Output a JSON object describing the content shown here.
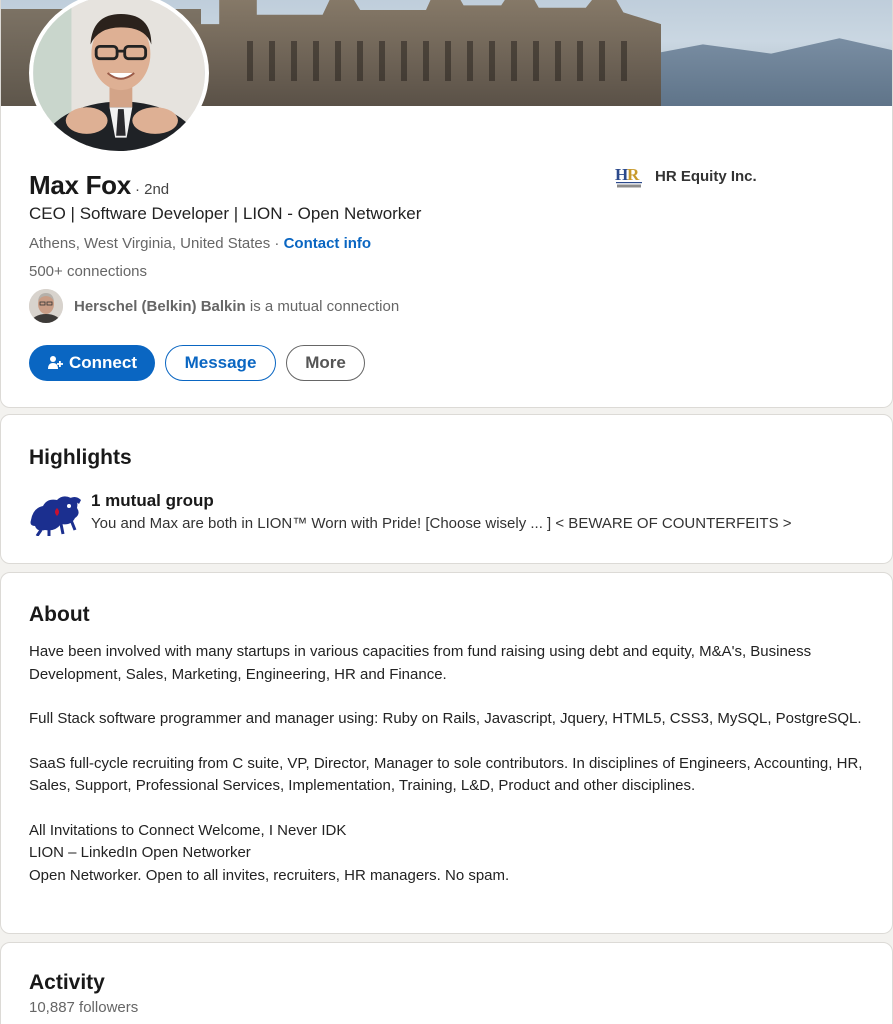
{
  "profile": {
    "name": "Max Fox",
    "degree": "· 2nd",
    "headline": "CEO | Software Developer | LION - Open Networker",
    "location": "Athens, West Virginia, United States",
    "location_separator": " · ",
    "contact_info": "Contact info",
    "connections": "500+ connections",
    "mutual": {
      "name": "Herschel (Belkin) Balkin",
      "suffix": " is a mutual connection"
    },
    "actions": {
      "connect": "Connect",
      "message": "Message",
      "more": "More"
    },
    "company": {
      "name": "HR Equity Inc.",
      "logo_icon": "hr-equity-logo"
    }
  },
  "highlights": {
    "title": "Highlights",
    "group_title": "1 mutual group",
    "group_desc": "You and Max are both in LION™ Worn with Pride! [Choose wisely ... ] < BEWARE OF COUNTERFEITS >",
    "group_icon": "lion-group-logo"
  },
  "about": {
    "title": "About",
    "paragraphs": [
      "Have been involved with many startups in various capacities from fund raising using debt and equity, M&A's, Business Development, Sales, Marketing, Engineering, HR and Finance.",
      "Full Stack software programmer and manager using: Ruby on Rails, Javascript, Jquery, HTML5, CSS3, MySQL, PostgreSQL.",
      "SaaS full-cycle recruiting from C suite, VP, Director, Manager to sole contributors. In disciplines of Engineers, Accounting, HR, Sales, Support, Professional Services, Implementation, Training, L&D, Product and other disciplines.",
      "All Invitations to Connect Welcome, I Never IDK",
      "LION – LinkedIn Open Networker",
      "Open Networker. Open to all invites, recruiters, HR managers. No spam."
    ]
  },
  "activity": {
    "title": "Activity",
    "followers": "10,887 followers"
  },
  "colors": {
    "primary": "#0a66c2",
    "background": "#f3f2ef",
    "card": "#ffffff"
  }
}
